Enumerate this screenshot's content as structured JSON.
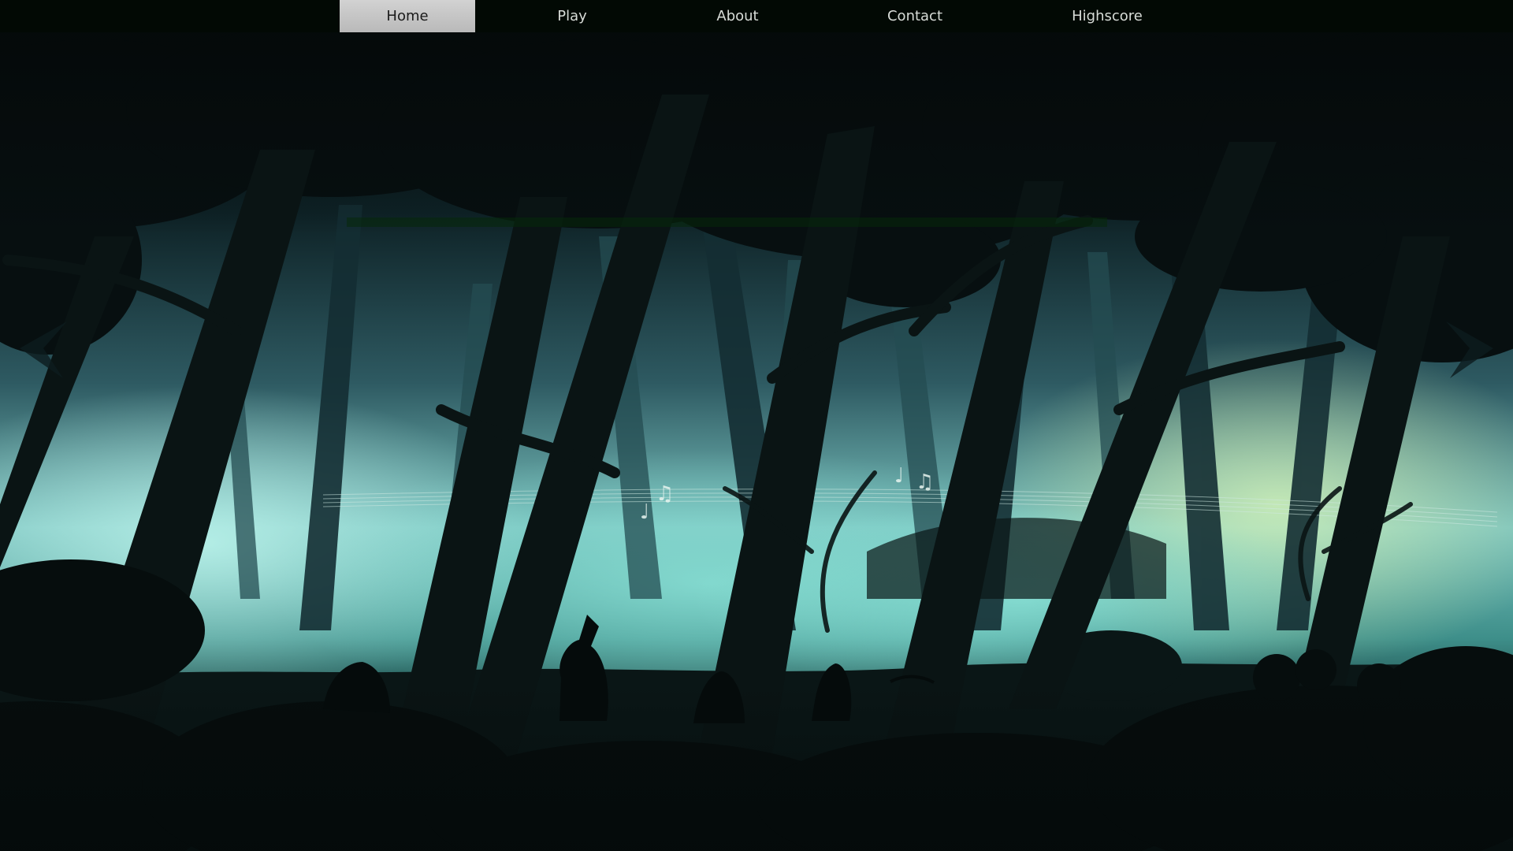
{
  "nav": {
    "items": [
      {
        "label": "Home",
        "active": true
      },
      {
        "label": "Play",
        "active": false
      },
      {
        "label": "About",
        "active": false
      },
      {
        "label": "Contact",
        "active": false
      },
      {
        "label": "Highscore",
        "active": false
      }
    ]
  },
  "slider": {
    "prev_icon": "chevron-left-icon",
    "next_icon": "chevron-right-icon"
  },
  "colors": {
    "navbar_bg": "#020a04",
    "nav_active_bg": "#c8c8c8",
    "nav_text": "#d8dcd8",
    "fog_light": "#9ef0e0",
    "fog_deep": "#2f7f80",
    "silhouette": "#07100f"
  }
}
